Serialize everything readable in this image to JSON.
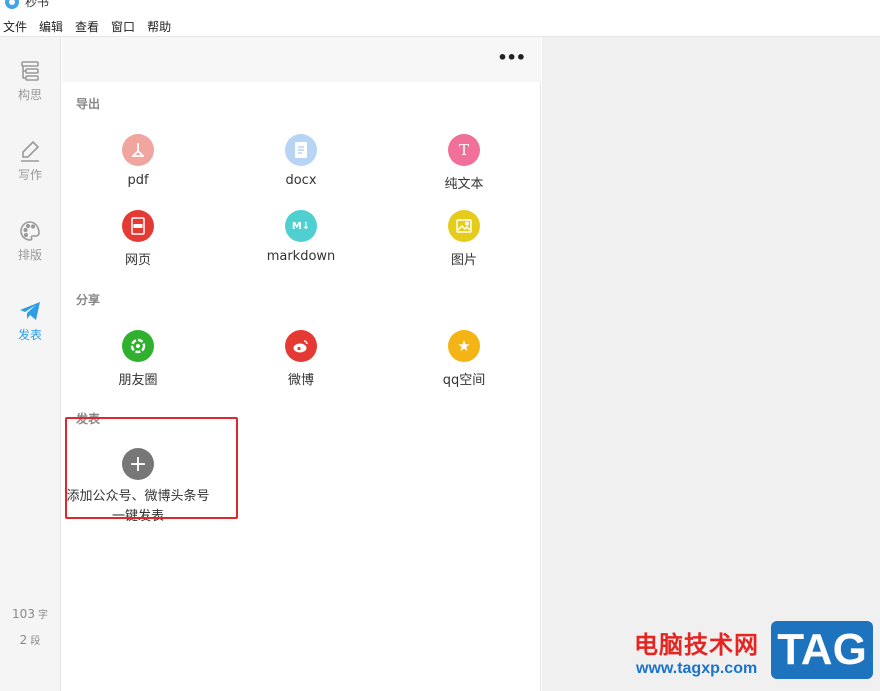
{
  "app": {
    "title": "秒书"
  },
  "menu": [
    "文件",
    "编辑",
    "查看",
    "窗口",
    "帮助"
  ],
  "sidebar": {
    "items": [
      {
        "label": "构思",
        "icon": "outline-icon",
        "active": false
      },
      {
        "label": "写作",
        "icon": "pen-icon",
        "active": false
      },
      {
        "label": "排版",
        "icon": "palette-icon",
        "active": false
      },
      {
        "label": "发表",
        "icon": "paper-plane-icon",
        "active": true
      }
    ],
    "word_count": "103",
    "word_unit": "字",
    "para_count": "2",
    "para_unit": "段"
  },
  "panel": {
    "more_label": "•••",
    "export": {
      "title": "导出",
      "options": [
        {
          "label": "pdf",
          "icon": "pdf-icon",
          "color": "#f0a59f"
        },
        {
          "label": "docx",
          "icon": "docx-icon",
          "color": "#b7d4f5"
        },
        {
          "label": "纯文本",
          "icon": "text-icon",
          "color": "#f0709a"
        },
        {
          "label": "网页",
          "icon": "html-icon",
          "color": "#e53a33"
        },
        {
          "label": "markdown",
          "icon": "markdown-icon",
          "color": "#4fcfcf"
        },
        {
          "label": "图片",
          "icon": "image-icon",
          "color": "#e6cc1a"
        }
      ]
    },
    "share": {
      "title": "分享",
      "options": [
        {
          "label": "朋友圈",
          "icon": "moments-icon",
          "color": "#2fb12f"
        },
        {
          "label": "微博",
          "icon": "weibo-icon",
          "color": "#e53a33"
        },
        {
          "label": "qq空间",
          "icon": "qzone-star-icon",
          "color": "#f4b416"
        }
      ]
    },
    "publish": {
      "title": "发表",
      "add_label": "添加公众号、微博头条号一键发表",
      "add_icon": "plus-icon",
      "add_color": "#777777"
    }
  },
  "watermark": {
    "site_name": "电脑技术网",
    "url": "www.tagxp.com",
    "tag": "TAG"
  }
}
